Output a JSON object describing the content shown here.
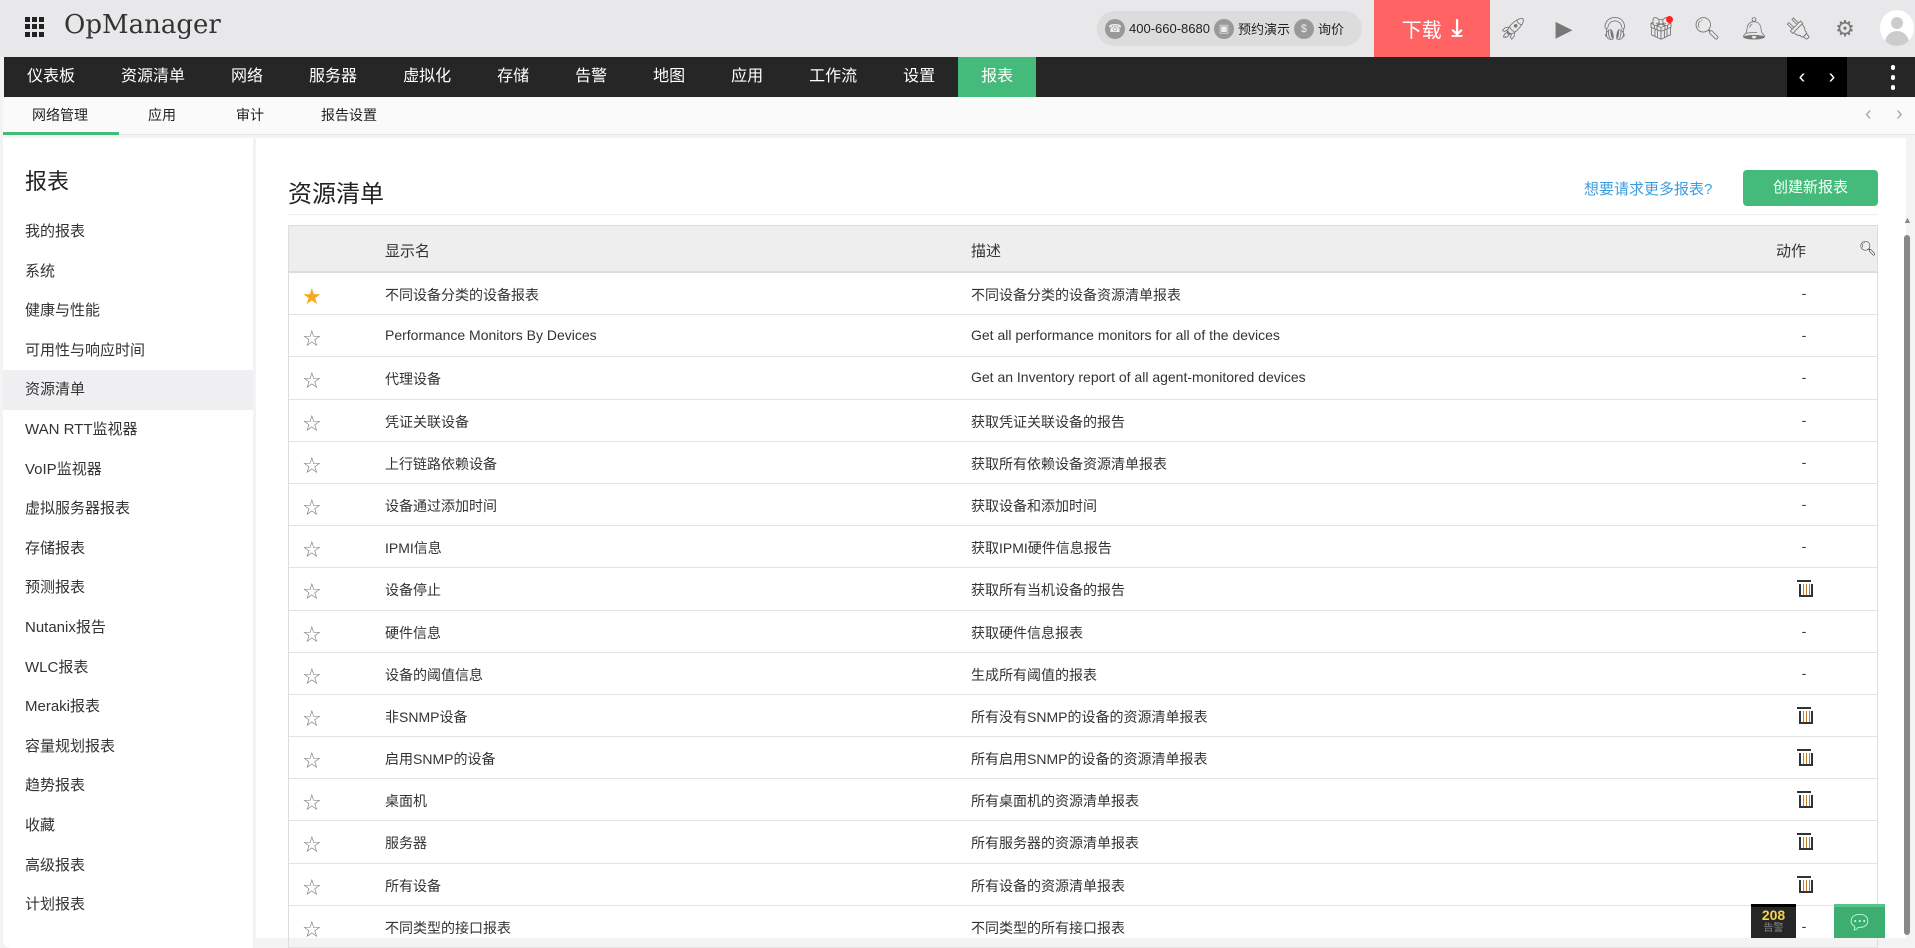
{
  "app": {
    "title": "OpManager"
  },
  "header": {
    "phone": "400-660-8680",
    "demo": "预约演示",
    "price": "询价",
    "price_icon": "$",
    "download": "下载",
    "icons": [
      "rocket-icon",
      "presentation-icon",
      "headset-icon",
      "gift-icon",
      "search-icon",
      "bell-icon",
      "plug-icon",
      "gear-icon",
      "avatar"
    ]
  },
  "nav": {
    "items": [
      "仪表板",
      "资源清单",
      "网络",
      "服务器",
      "虚拟化",
      "存储",
      "告警",
      "地图",
      "应用",
      "工作流",
      "设置",
      "报表"
    ],
    "active": "报表"
  },
  "subnav": {
    "items": [
      "网络管理",
      "应用",
      "审计",
      "报告设置"
    ],
    "active": "网络管理"
  },
  "sidebar": {
    "title": "报表",
    "items": [
      "我的报表",
      "系统",
      "健康与性能",
      "可用性与响应时间",
      "资源清单",
      "WAN RTT监视器",
      "VoIP监视器",
      "虚拟服务器报表",
      "存储报表",
      "预测报表",
      "Nutanix报告",
      "WLC报表",
      "Meraki报表",
      "容量规划报表",
      "趋势报表",
      "收藏",
      "高级报表",
      "计划报表"
    ],
    "active": "资源清单"
  },
  "main": {
    "title": "资源清单",
    "more_link": "想要请求更多报表?",
    "create_button": "创建新报表",
    "columns": {
      "name": "显示名",
      "desc": "描述",
      "action": "动作"
    },
    "rows": [
      {
        "fav": true,
        "name": "不同设备分类的设备报表",
        "desc": "不同设备分类的设备资源清单报表",
        "action": "-"
      },
      {
        "fav": false,
        "name": "Performance Monitors By Devices",
        "desc": "Get all performance monitors for all of the devices",
        "action": "-"
      },
      {
        "fav": false,
        "name": "代理设备",
        "desc": "Get an Inventory report of all agent-monitored devices",
        "action": "-"
      },
      {
        "fav": false,
        "name": "凭证关联设备",
        "desc": "获取凭证关联设备的报告",
        "action": "-"
      },
      {
        "fav": false,
        "name": "上行链路依赖设备",
        "desc": "获取所有依赖设备资源清单报表",
        "action": "-"
      },
      {
        "fav": false,
        "name": "设备通过添加时间",
        "desc": "获取设备和添加时间",
        "action": "-"
      },
      {
        "fav": false,
        "name": "IPMI信息",
        "desc": "获取IPMI硬件信息报告",
        "action": "-"
      },
      {
        "fav": false,
        "name": "设备停止",
        "desc": "获取所有当机设备的报告",
        "action": "delete"
      },
      {
        "fav": false,
        "name": "硬件信息",
        "desc": "获取硬件信息报表",
        "action": "-"
      },
      {
        "fav": false,
        "name": "设备的阈值信息",
        "desc": "生成所有阈值的报表",
        "action": "-"
      },
      {
        "fav": false,
        "name": "非SNMP设备",
        "desc": "所有没有SNMP的设备的资源清单报表",
        "action": "delete"
      },
      {
        "fav": false,
        "name": "启用SNMP的设备",
        "desc": "所有启用SNMP的设备的资源清单报表",
        "action": "delete"
      },
      {
        "fav": false,
        "name": "桌面机",
        "desc": "所有桌面机的资源清单报表",
        "action": "delete"
      },
      {
        "fav": false,
        "name": "服务器",
        "desc": "所有服务器的资源清单报表",
        "action": "delete"
      },
      {
        "fav": false,
        "name": "所有设备",
        "desc": "所有设备的资源清单报表",
        "action": "delete"
      },
      {
        "fav": false,
        "name": "不同类型的接口报表",
        "desc": "不同类型的所有接口报表",
        "action": "-"
      }
    ]
  },
  "footer": {
    "alarm_count": "208",
    "alarm_label": "告警"
  },
  "colors": {
    "accent": "#45bb7b",
    "download": "#ff6363",
    "nav_bg": "#262626",
    "link": "#3b9ee0",
    "star": "#f8a81c"
  }
}
